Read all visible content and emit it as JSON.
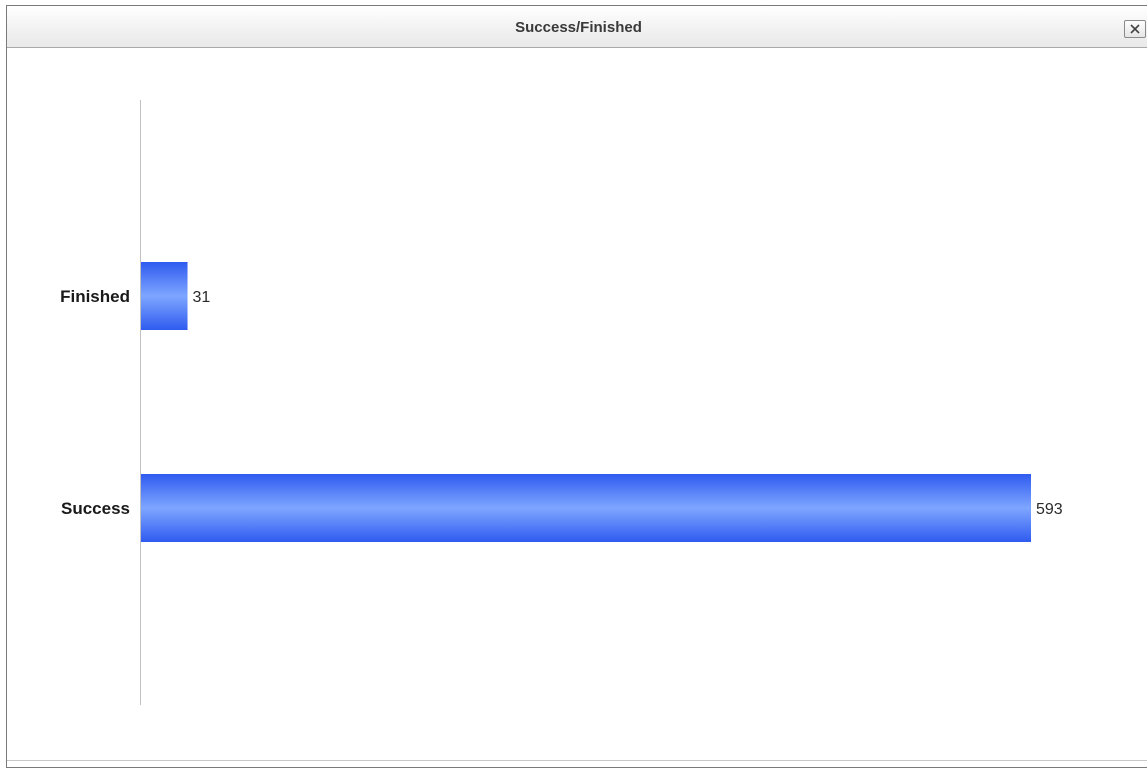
{
  "window": {
    "title": "Success/Finished",
    "close_icon": "close-icon"
  },
  "colors": {
    "bar_main": "#2f5bf0",
    "bar_highlight": "#7ea6ff",
    "axis": "#c0c0c0"
  },
  "chart_data": {
    "type": "bar",
    "orientation": "horizontal",
    "title": "",
    "xlabel": "",
    "ylabel": "",
    "categories": [
      "Finished",
      "Success"
    ],
    "values": [
      31,
      593
    ],
    "xlim": [
      0,
      593
    ],
    "grid": false,
    "legend": "none",
    "series": [
      {
        "values": [
          31,
          593
        ]
      }
    ]
  }
}
